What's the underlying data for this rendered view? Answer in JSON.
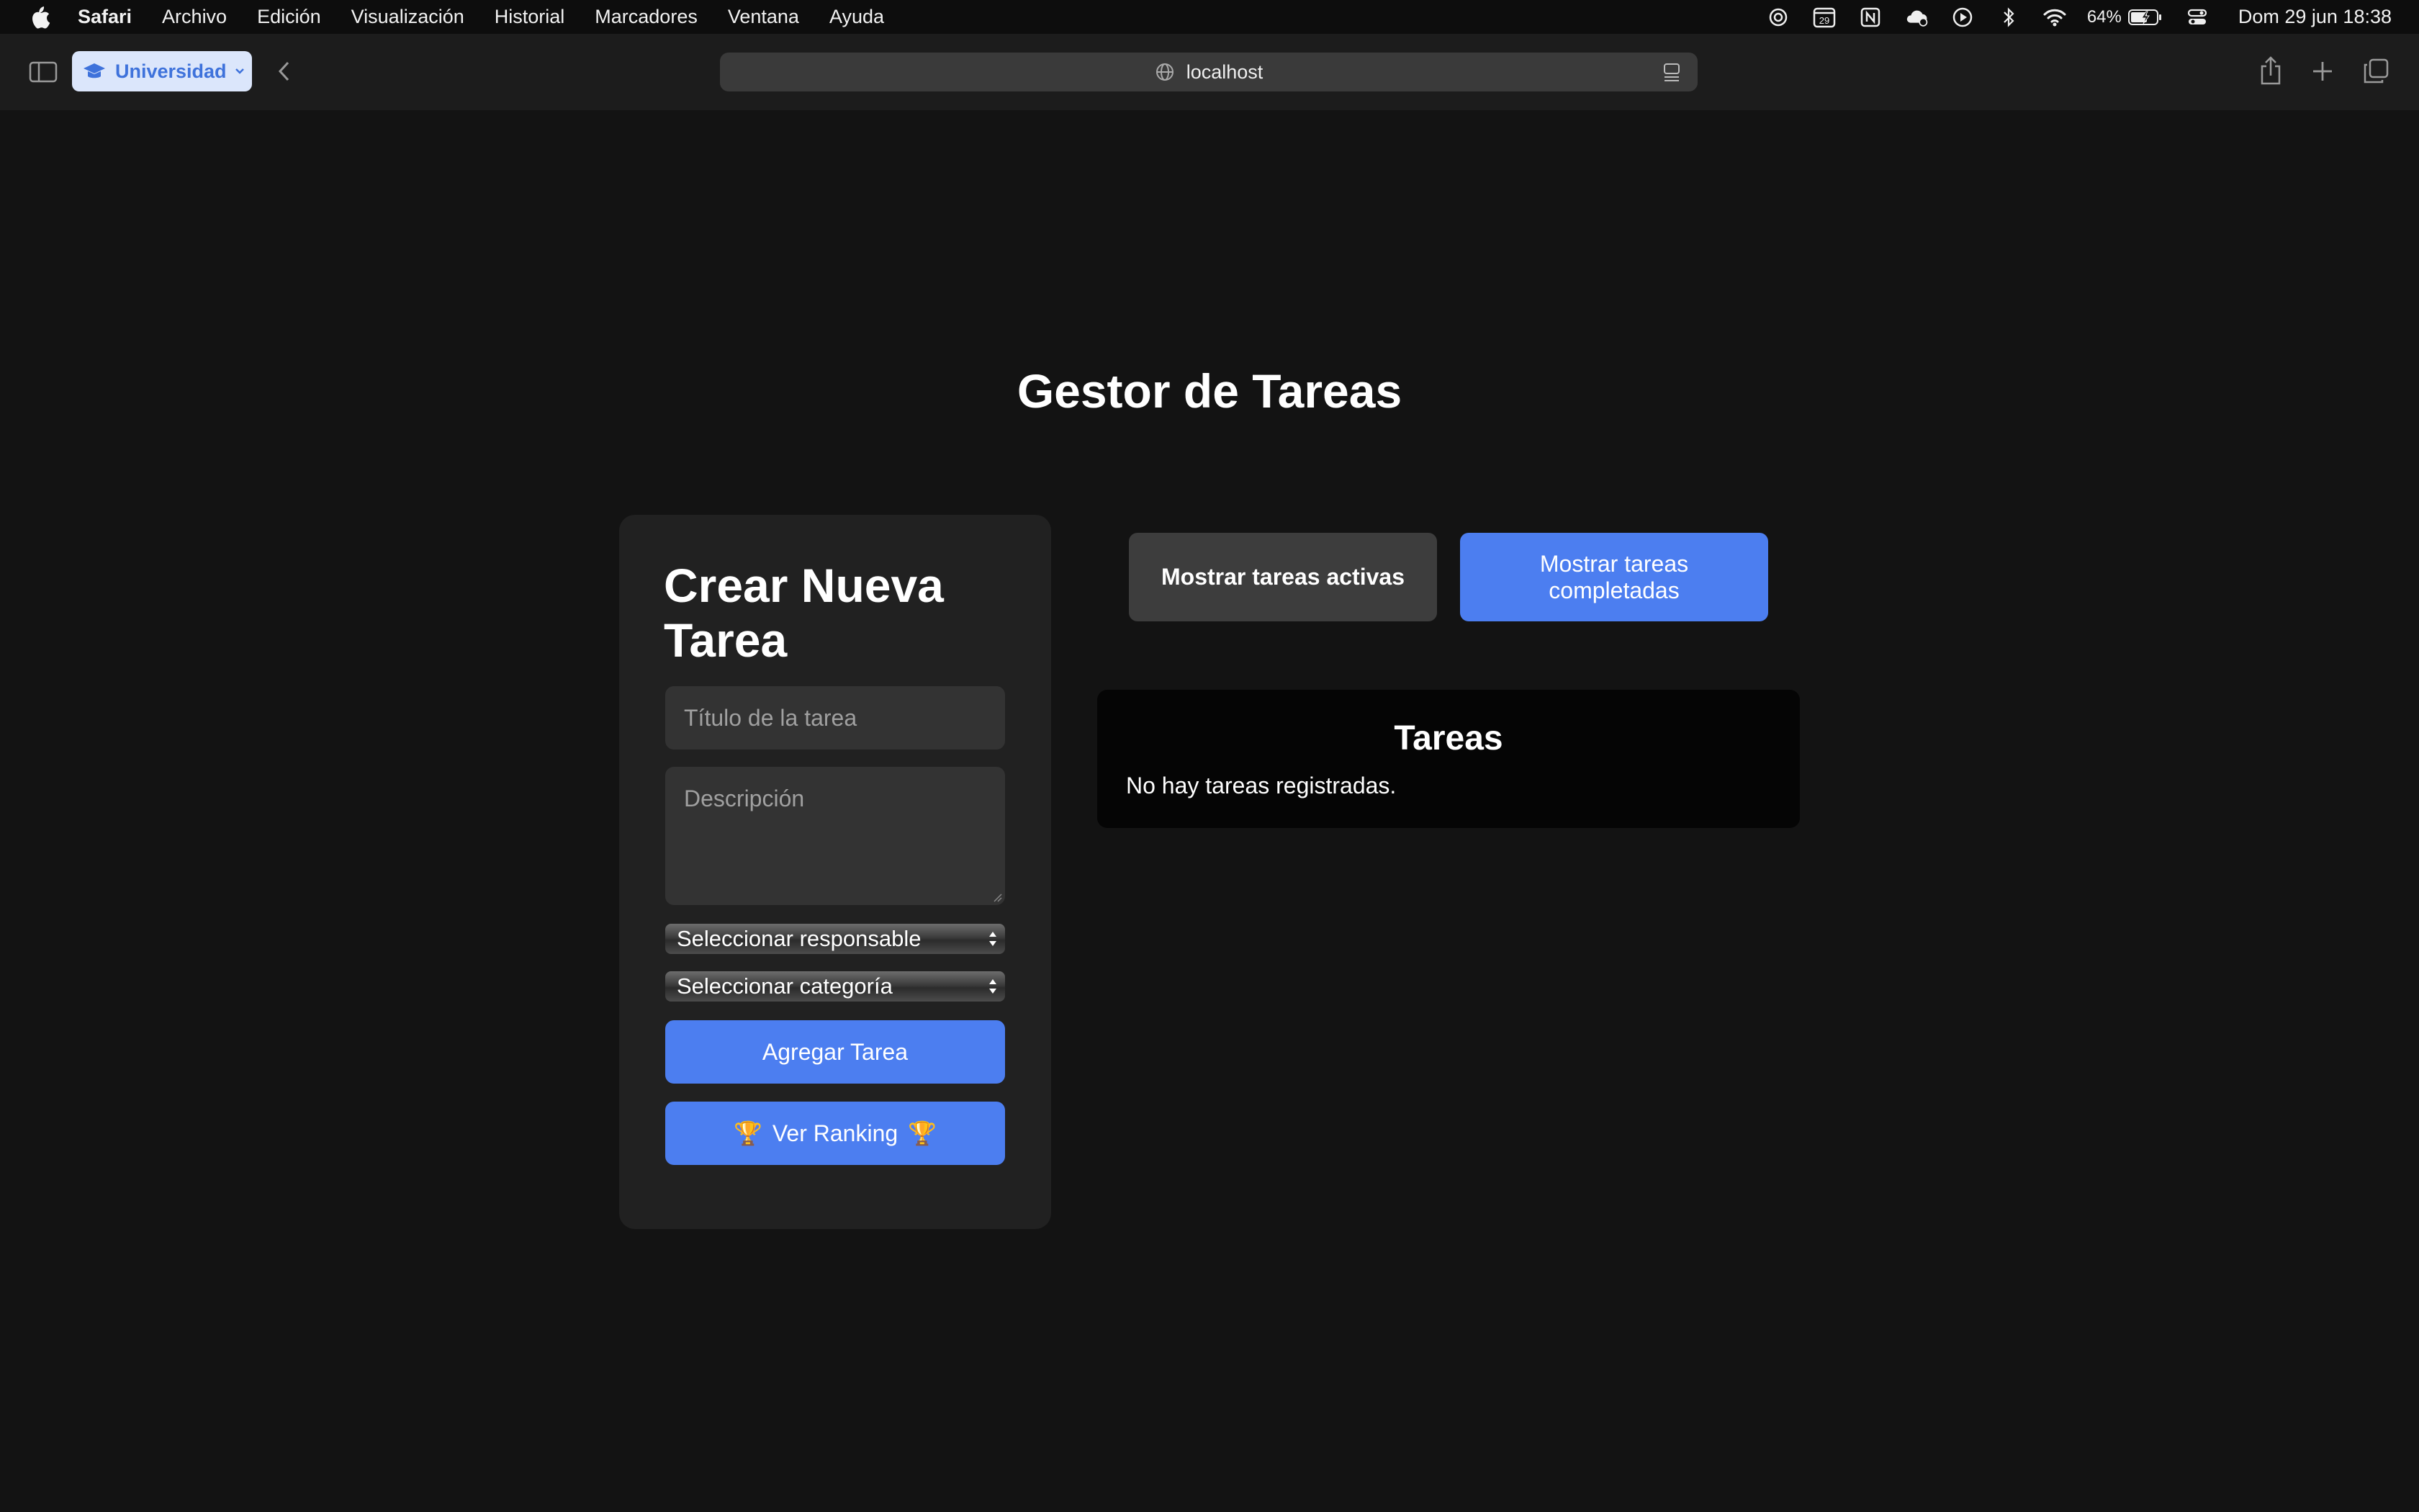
{
  "menubar": {
    "app_name": "Safari",
    "items": [
      "Archivo",
      "Edición",
      "Visualización",
      "Historial",
      "Marcadores",
      "Ventana",
      "Ayuda"
    ],
    "calendar_day": "29",
    "battery": "64%",
    "clock": "Dom 29 jun  18:38"
  },
  "browser": {
    "profile_label": "Universidad",
    "url": "localhost",
    "accent_color": "#3e72db"
  },
  "page": {
    "title": "Gestor de Tareas",
    "form": {
      "heading": "Crear Nueva Tarea",
      "title_placeholder": "Título de la tarea",
      "description_placeholder": "Descripción",
      "responsible_select": "Seleccionar responsable",
      "category_select": "Seleccionar categoría",
      "add_button": "Agregar Tarea",
      "ranking_button": "Ver Ranking",
      "ranking_emoji": "🏆"
    },
    "filters": {
      "active_button": "Mostrar tareas activas",
      "completed_button": "Mostrar tareas completadas"
    },
    "tasks": {
      "heading": "Tareas",
      "empty_message": "No hay tareas registradas."
    },
    "colors": {
      "primary_button": "#4c7ef0",
      "background": "#131313",
      "card": "#212121"
    }
  }
}
